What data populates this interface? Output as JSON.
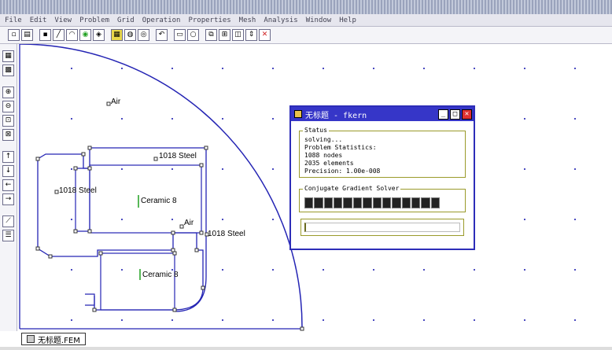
{
  "app": {
    "menu": [
      "File",
      "Edit",
      "View",
      "Problem",
      "Grid",
      "Operation",
      "Properties",
      "Mesh",
      "Analysis",
      "Window",
      "Help"
    ]
  },
  "toolbar": {
    "buttons": [
      "new-icon",
      "open-icon",
      "node-icon",
      "segment-icon",
      "arc-icon",
      "block-icon",
      "group-icon",
      "mesh-icon",
      "material-icon",
      "boundary-icon",
      "undo-icon",
      "rect-icon",
      "circle-icon",
      "copy-icon",
      "move-icon",
      "mirror-icon",
      "scale-icon",
      "delete-icon"
    ]
  },
  "canvas": {
    "labels": {
      "air_top": "Air",
      "steel_top": "1018 Steel",
      "steel_left": "1018 Steel",
      "ceramic_top": "Ceramic 8",
      "air_mid": "Air",
      "steel_right": "1018 Steel",
      "ceramic_bottom": "Ceramic 8"
    }
  },
  "doc_tab": {
    "label": "无标题.FEM"
  },
  "solver_dialog": {
    "title": "无标题 - fkern",
    "status": {
      "legend": "Status",
      "lines": [
        "solving...",
        "Problem Statistics:",
        "1088 nodes",
        "2035 elements",
        "Precision: 1.00e-008"
      ]
    },
    "progress": {
      "legend": "Conjugate Gradient Solver",
      "segments": 14
    }
  },
  "colors": {
    "dialog_title_bg": "#3636c8",
    "geometry_line": "#2424b4",
    "node_color": "#333333"
  }
}
